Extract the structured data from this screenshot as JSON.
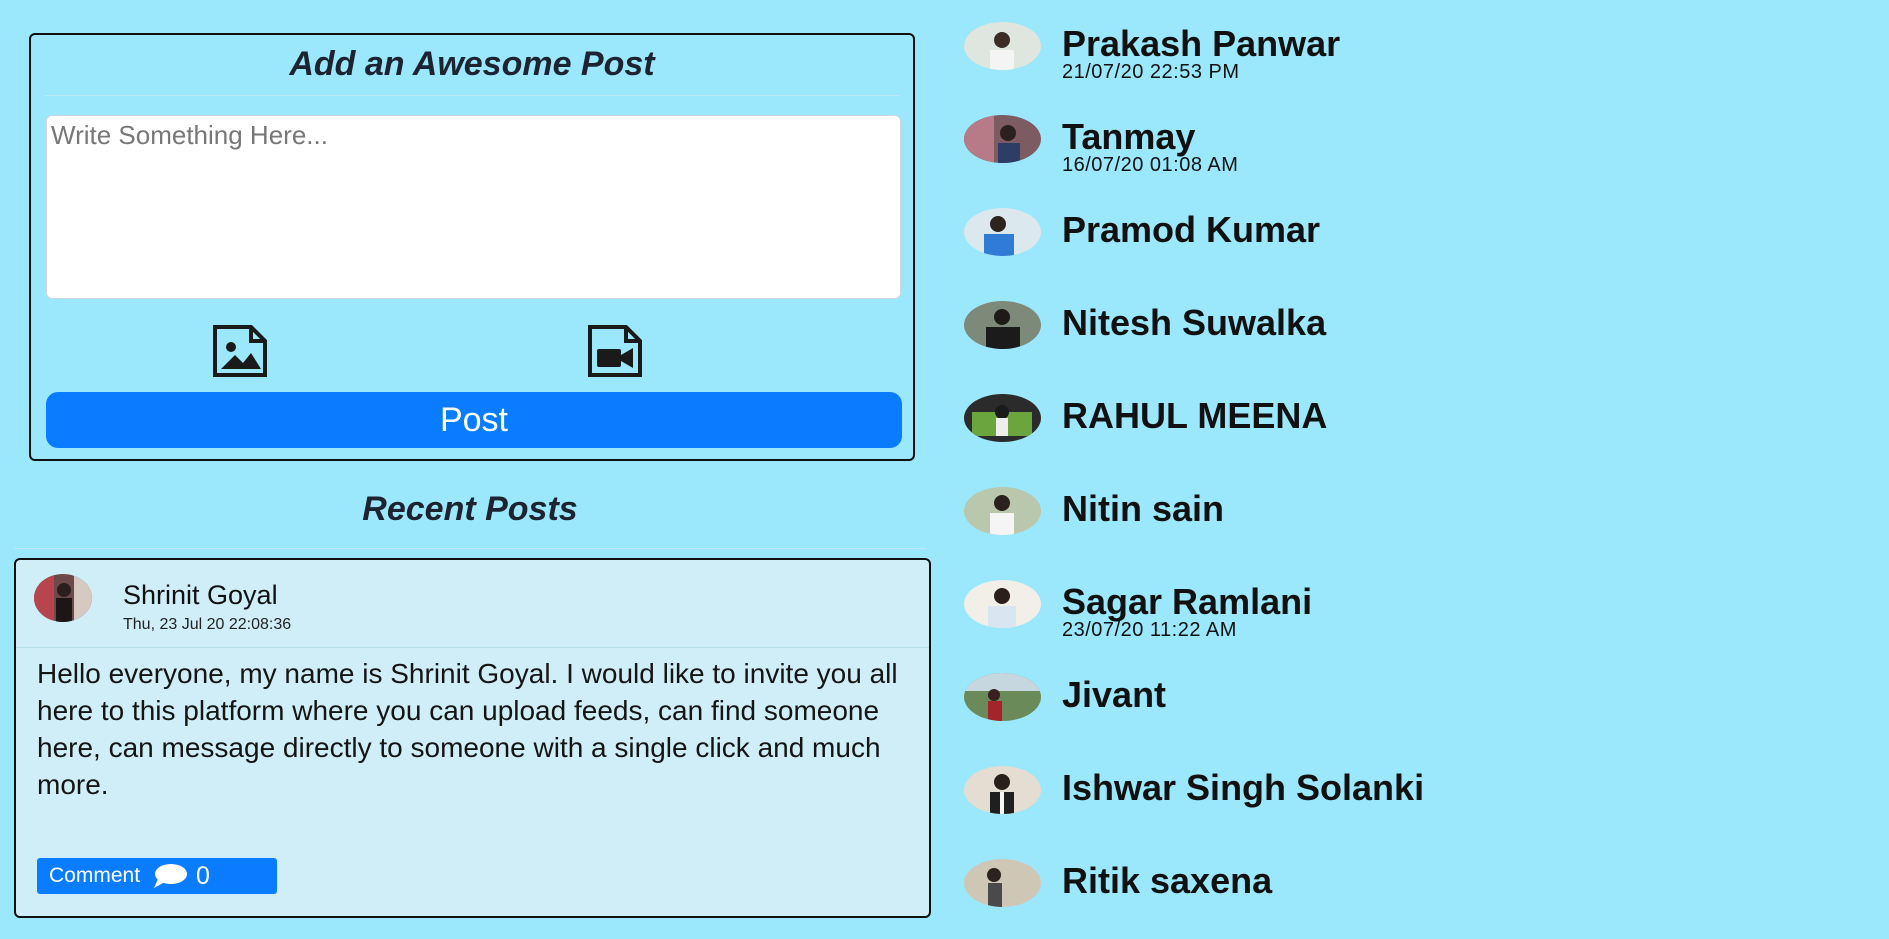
{
  "composer": {
    "title": "Add an Awesome Post",
    "placeholder": "Write Something Here...",
    "post_label": "Post",
    "image_icon": "image-file-icon",
    "video_icon": "video-file-icon"
  },
  "recent": {
    "title": "Recent Posts",
    "post": {
      "author": "Shrinit Goyal",
      "time": "Thu, 23 Jul 20 22:08:36",
      "body": "Hello everyone, my name is Shrinit Goyal. I would like to invite you all here to this platform where you can upload feeds, can find someone here, can message directly to someone with a single click and much more.",
      "comment_label": "Comment",
      "comment_count": "0"
    }
  },
  "users": [
    {
      "name": "Prakash Panwar",
      "time": "21/07/20 22:53 PM"
    },
    {
      "name": "Tanmay",
      "time": "16/07/20 01:08 AM"
    },
    {
      "name": "Pramod Kumar",
      "time": ""
    },
    {
      "name": "Nitesh Suwalka",
      "time": ""
    },
    {
      "name": "RAHUL MEENA",
      "time": ""
    },
    {
      "name": "Nitin sain",
      "time": ""
    },
    {
      "name": "Sagar Ramlani",
      "time": "23/07/20 11:22 AM"
    },
    {
      "name": "Jivant",
      "time": ""
    },
    {
      "name": "Ishwar Singh Solanki",
      "time": ""
    },
    {
      "name": "Ritik saxena",
      "time": ""
    }
  ],
  "colors": {
    "background": "#9be7fb",
    "primary": "#0a7cff",
    "card": "#cfeef8"
  }
}
